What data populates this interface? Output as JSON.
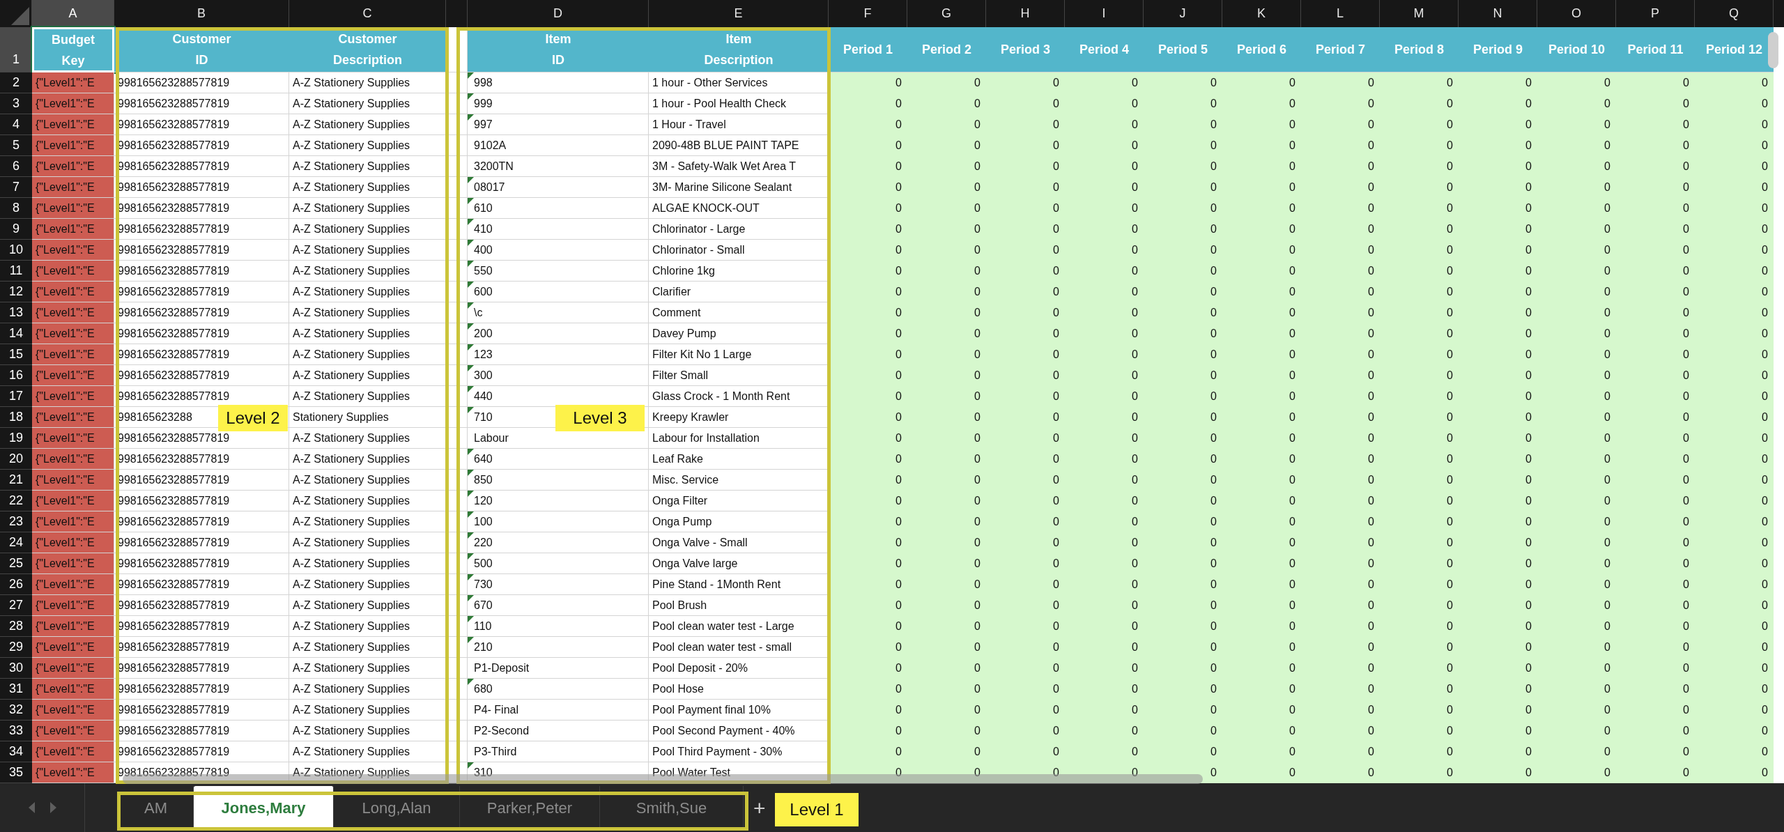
{
  "column_letters": [
    {
      "label": "A",
      "selected": true
    },
    {
      "label": "B",
      "selected": false
    },
    {
      "label": "C",
      "selected": false
    },
    {
      "label": "D",
      "selected": false
    },
    {
      "label": "E",
      "selected": false
    },
    {
      "label": "F",
      "selected": false
    },
    {
      "label": "G",
      "selected": false
    },
    {
      "label": "H",
      "selected": false
    },
    {
      "label": "I",
      "selected": false
    },
    {
      "label": "J",
      "selected": false
    },
    {
      "label": "K",
      "selected": false
    },
    {
      "label": "L",
      "selected": false
    },
    {
      "label": "M",
      "selected": false
    },
    {
      "label": "N",
      "selected": false
    },
    {
      "label": "O",
      "selected": false
    },
    {
      "label": "P",
      "selected": false
    },
    {
      "label": "Q",
      "selected": false
    }
  ],
  "header_row": {
    "number": "1",
    "selected": true,
    "cells": [
      "Budget\nKey",
      "Customer\nID",
      "Customer\nDescription",
      "Item\nID",
      "Item\nDescription",
      "Period 1",
      "Period 2",
      "Period 3",
      "Period 4",
      "Period 5",
      "Period 6",
      "Period 7",
      "Period 8",
      "Period 9",
      "Period 10",
      "Period 11",
      "Period 12"
    ]
  },
  "rows": [
    {
      "number": "2",
      "budget_key": "{\"Level1\":\"E",
      "customer_id": "998165623288577819",
      "customer_description": "A-Z Stationery Supplies",
      "item_id": "998",
      "item_flagged": true,
      "item_description": "1 hour - Other Services",
      "periods": [
        "0",
        "0",
        "0",
        "0",
        "0",
        "0",
        "0",
        "0",
        "0",
        "0",
        "0",
        "0"
      ]
    },
    {
      "number": "3",
      "budget_key": "{\"Level1\":\"E",
      "customer_id": "998165623288577819",
      "customer_description": "A-Z Stationery Supplies",
      "item_id": "999",
      "item_flagged": true,
      "item_description": "1 hour - Pool Health Check",
      "periods": [
        "0",
        "0",
        "0",
        "0",
        "0",
        "0",
        "0",
        "0",
        "0",
        "0",
        "0",
        "0"
      ]
    },
    {
      "number": "4",
      "budget_key": "{\"Level1\":\"E",
      "customer_id": "998165623288577819",
      "customer_description": "A-Z Stationery Supplies",
      "item_id": "997",
      "item_flagged": true,
      "item_description": "1 Hour - Travel",
      "periods": [
        "0",
        "0",
        "0",
        "0",
        "0",
        "0",
        "0",
        "0",
        "0",
        "0",
        "0",
        "0"
      ]
    },
    {
      "number": "5",
      "budget_key": "{\"Level1\":\"E",
      "customer_id": "998165623288577819",
      "customer_description": "A-Z Stationery Supplies",
      "item_id": "9102A",
      "item_flagged": false,
      "item_description": "2090-48B BLUE PAINT TAPE",
      "periods": [
        "0",
        "0",
        "0",
        "0",
        "0",
        "0",
        "0",
        "0",
        "0",
        "0",
        "0",
        "0"
      ]
    },
    {
      "number": "6",
      "budget_key": "{\"Level1\":\"E",
      "customer_id": "998165623288577819",
      "customer_description": "A-Z Stationery Supplies",
      "item_id": "3200TN",
      "item_flagged": false,
      "item_description": "3M - Safety-Walk Wet Area T",
      "periods": [
        "0",
        "0",
        "0",
        "0",
        "0",
        "0",
        "0",
        "0",
        "0",
        "0",
        "0",
        "0"
      ]
    },
    {
      "number": "7",
      "budget_key": "{\"Level1\":\"E",
      "customer_id": "998165623288577819",
      "customer_description": "A-Z Stationery Supplies",
      "item_id": "08017",
      "item_flagged": true,
      "item_description": "3M- Marine Silicone Sealant",
      "periods": [
        "0",
        "0",
        "0",
        "0",
        "0",
        "0",
        "0",
        "0",
        "0",
        "0",
        "0",
        "0"
      ]
    },
    {
      "number": "8",
      "budget_key": "{\"Level1\":\"E",
      "customer_id": "998165623288577819",
      "customer_description": "A-Z Stationery Supplies",
      "item_id": "610",
      "item_flagged": true,
      "item_description": "ALGAE KNOCK-OUT",
      "periods": [
        "0",
        "0",
        "0",
        "0",
        "0",
        "0",
        "0",
        "0",
        "0",
        "0",
        "0",
        "0"
      ]
    },
    {
      "number": "9",
      "budget_key": "{\"Level1\":\"E",
      "customer_id": "998165623288577819",
      "customer_description": "A-Z Stationery Supplies",
      "item_id": "410",
      "item_flagged": true,
      "item_description": "Chlorinator - Large",
      "periods": [
        "0",
        "0",
        "0",
        "0",
        "0",
        "0",
        "0",
        "0",
        "0",
        "0",
        "0",
        "0"
      ]
    },
    {
      "number": "10",
      "budget_key": "{\"Level1\":\"E",
      "customer_id": "998165623288577819",
      "customer_description": "A-Z Stationery Supplies",
      "item_id": "400",
      "item_flagged": true,
      "item_description": "Chlorinator - Small",
      "periods": [
        "0",
        "0",
        "0",
        "0",
        "0",
        "0",
        "0",
        "0",
        "0",
        "0",
        "0",
        "0"
      ]
    },
    {
      "number": "11",
      "budget_key": "{\"Level1\":\"E",
      "customer_id": "998165623288577819",
      "customer_description": "A-Z Stationery Supplies",
      "item_id": "550",
      "item_flagged": true,
      "item_description": "Chlorine 1kg",
      "periods": [
        "0",
        "0",
        "0",
        "0",
        "0",
        "0",
        "0",
        "0",
        "0",
        "0",
        "0",
        "0"
      ]
    },
    {
      "number": "12",
      "budget_key": "{\"Level1\":\"E",
      "customer_id": "998165623288577819",
      "customer_description": "A-Z Stationery Supplies",
      "item_id": "600",
      "item_flagged": true,
      "item_description": "Clarifier",
      "periods": [
        "0",
        "0",
        "0",
        "0",
        "0",
        "0",
        "0",
        "0",
        "0",
        "0",
        "0",
        "0"
      ]
    },
    {
      "number": "13",
      "budget_key": "{\"Level1\":\"E",
      "customer_id": "998165623288577819",
      "customer_description": "A-Z Stationery Supplies",
      "item_id": "\\c",
      "item_flagged": true,
      "item_description": "Comment",
      "periods": [
        "0",
        "0",
        "0",
        "0",
        "0",
        "0",
        "0",
        "0",
        "0",
        "0",
        "0",
        "0"
      ]
    },
    {
      "number": "14",
      "budget_key": "{\"Level1\":\"E",
      "customer_id": "998165623288577819",
      "customer_description": "A-Z Stationery Supplies",
      "item_id": "200",
      "item_flagged": true,
      "item_description": "Davey Pump",
      "periods": [
        "0",
        "0",
        "0",
        "0",
        "0",
        "0",
        "0",
        "0",
        "0",
        "0",
        "0",
        "0"
      ]
    },
    {
      "number": "15",
      "budget_key": "{\"Level1\":\"E",
      "customer_id": "998165623288577819",
      "customer_description": "A-Z Stationery Supplies",
      "item_id": "123",
      "item_flagged": true,
      "item_description": "Filter Kit No 1 Large",
      "periods": [
        "0",
        "0",
        "0",
        "0",
        "0",
        "0",
        "0",
        "0",
        "0",
        "0",
        "0",
        "0"
      ]
    },
    {
      "number": "16",
      "budget_key": "{\"Level1\":\"E",
      "customer_id": "998165623288577819",
      "customer_description": "A-Z Stationery Supplies",
      "item_id": "300",
      "item_flagged": true,
      "item_description": "Filter Small",
      "periods": [
        "0",
        "0",
        "0",
        "0",
        "0",
        "0",
        "0",
        "0",
        "0",
        "0",
        "0",
        "0"
      ]
    },
    {
      "number": "17",
      "budget_key": "{\"Level1\":\"E",
      "customer_id": "998165623288577819",
      "customer_description": "A-Z Stationery Supplies",
      "item_id": "440",
      "item_flagged": true,
      "item_description": "Glass Crock - 1 Month Rent",
      "periods": [
        "0",
        "0",
        "0",
        "0",
        "0",
        "0",
        "0",
        "0",
        "0",
        "0",
        "0",
        "0"
      ]
    },
    {
      "number": "18",
      "budget_key": "{\"Level1\":\"E",
      "customer_id": "998165623288",
      "customer_description": "Stationery Supplies",
      "item_id": "710",
      "item_flagged": true,
      "item_description": "Kreepy Krawler",
      "periods": [
        "0",
        "0",
        "0",
        "0",
        "0",
        "0",
        "0",
        "0",
        "0",
        "0",
        "0",
        "0"
      ]
    },
    {
      "number": "19",
      "budget_key": "{\"Level1\":\"E",
      "customer_id": "998165623288577819",
      "customer_description": "A-Z Stationery Supplies",
      "item_id": "Labour",
      "item_flagged": false,
      "item_description": "Labour for Installation",
      "periods": [
        "0",
        "0",
        "0",
        "0",
        "0",
        "0",
        "0",
        "0",
        "0",
        "0",
        "0",
        "0"
      ]
    },
    {
      "number": "20",
      "budget_key": "{\"Level1\":\"E",
      "customer_id": "998165623288577819",
      "customer_description": "A-Z Stationery Supplies",
      "item_id": "640",
      "item_flagged": true,
      "item_description": "Leaf Rake",
      "periods": [
        "0",
        "0",
        "0",
        "0",
        "0",
        "0",
        "0",
        "0",
        "0",
        "0",
        "0",
        "0"
      ]
    },
    {
      "number": "21",
      "budget_key": "{\"Level1\":\"E",
      "customer_id": "998165623288577819",
      "customer_description": "A-Z Stationery Supplies",
      "item_id": "850",
      "item_flagged": true,
      "item_description": "Misc. Service",
      "periods": [
        "0",
        "0",
        "0",
        "0",
        "0",
        "0",
        "0",
        "0",
        "0",
        "0",
        "0",
        "0"
      ]
    },
    {
      "number": "22",
      "budget_key": "{\"Level1\":\"E",
      "customer_id": "998165623288577819",
      "customer_description": "A-Z Stationery Supplies",
      "item_id": "120",
      "item_flagged": true,
      "item_description": "Onga  Filter",
      "periods": [
        "0",
        "0",
        "0",
        "0",
        "0",
        "0",
        "0",
        "0",
        "0",
        "0",
        "0",
        "0"
      ]
    },
    {
      "number": "23",
      "budget_key": "{\"Level1\":\"E",
      "customer_id": "998165623288577819",
      "customer_description": "A-Z Stationery Supplies",
      "item_id": "100",
      "item_flagged": true,
      "item_description": "Onga Pump",
      "periods": [
        "0",
        "0",
        "0",
        "0",
        "0",
        "0",
        "0",
        "0",
        "0",
        "0",
        "0",
        "0"
      ]
    },
    {
      "number": "24",
      "budget_key": "{\"Level1\":\"E",
      "customer_id": "998165623288577819",
      "customer_description": "A-Z Stationery Supplies",
      "item_id": "220",
      "item_flagged": true,
      "item_description": "Onga Valve - Small",
      "periods": [
        "0",
        "0",
        "0",
        "0",
        "0",
        "0",
        "0",
        "0",
        "0",
        "0",
        "0",
        "0"
      ]
    },
    {
      "number": "25",
      "budget_key": "{\"Level1\":\"E",
      "customer_id": "998165623288577819",
      "customer_description": "A-Z Stationery Supplies",
      "item_id": "500",
      "item_flagged": true,
      "item_description": "Onga Valve large",
      "periods": [
        "0",
        "0",
        "0",
        "0",
        "0",
        "0",
        "0",
        "0",
        "0",
        "0",
        "0",
        "0"
      ]
    },
    {
      "number": "26",
      "budget_key": "{\"Level1\":\"E",
      "customer_id": "998165623288577819",
      "customer_description": "A-Z Stationery Supplies",
      "item_id": "730",
      "item_flagged": true,
      "item_description": "Pine Stand - 1Month Rent",
      "periods": [
        "0",
        "0",
        "0",
        "0",
        "0",
        "0",
        "0",
        "0",
        "0",
        "0",
        "0",
        "0"
      ]
    },
    {
      "number": "27",
      "budget_key": "{\"Level1\":\"E",
      "customer_id": "998165623288577819",
      "customer_description": "A-Z Stationery Supplies",
      "item_id": "670",
      "item_flagged": true,
      "item_description": "Pool Brush",
      "periods": [
        "0",
        "0",
        "0",
        "0",
        "0",
        "0",
        "0",
        "0",
        "0",
        "0",
        "0",
        "0"
      ]
    },
    {
      "number": "28",
      "budget_key": "{\"Level1\":\"E",
      "customer_id": "998165623288577819",
      "customer_description": "A-Z Stationery Supplies",
      "item_id": "110",
      "item_flagged": true,
      "item_description": "Pool clean water test - Large",
      "periods": [
        "0",
        "0",
        "0",
        "0",
        "0",
        "0",
        "0",
        "0",
        "0",
        "0",
        "0",
        "0"
      ]
    },
    {
      "number": "29",
      "budget_key": "{\"Level1\":\"E",
      "customer_id": "998165623288577819",
      "customer_description": "A-Z Stationery Supplies",
      "item_id": "210",
      "item_flagged": true,
      "item_description": "Pool clean water test - small",
      "periods": [
        "0",
        "0",
        "0",
        "0",
        "0",
        "0",
        "0",
        "0",
        "0",
        "0",
        "0",
        "0"
      ]
    },
    {
      "number": "30",
      "budget_key": "{\"Level1\":\"E",
      "customer_id": "998165623288577819",
      "customer_description": "A-Z Stationery Supplies",
      "item_id": "P1-Deposit",
      "item_flagged": false,
      "item_description": "Pool Deposit - 20%",
      "periods": [
        "0",
        "0",
        "0",
        "0",
        "0",
        "0",
        "0",
        "0",
        "0",
        "0",
        "0",
        "0"
      ]
    },
    {
      "number": "31",
      "budget_key": "{\"Level1\":\"E",
      "customer_id": "998165623288577819",
      "customer_description": "A-Z Stationery Supplies",
      "item_id": "680",
      "item_flagged": true,
      "item_description": "Pool Hose",
      "periods": [
        "0",
        "0",
        "0",
        "0",
        "0",
        "0",
        "0",
        "0",
        "0",
        "0",
        "0",
        "0"
      ]
    },
    {
      "number": "32",
      "budget_key": "{\"Level1\":\"E",
      "customer_id": "998165623288577819",
      "customer_description": "A-Z Stationery Supplies",
      "item_id": "P4- Final",
      "item_flagged": false,
      "item_description": "Pool Payment final 10%",
      "periods": [
        "0",
        "0",
        "0",
        "0",
        "0",
        "0",
        "0",
        "0",
        "0",
        "0",
        "0",
        "0"
      ]
    },
    {
      "number": "33",
      "budget_key": "{\"Level1\":\"E",
      "customer_id": "998165623288577819",
      "customer_description": "A-Z Stationery Supplies",
      "item_id": "P2-Second",
      "item_flagged": false,
      "item_description": "Pool Second Payment - 40%",
      "periods": [
        "0",
        "0",
        "0",
        "0",
        "0",
        "0",
        "0",
        "0",
        "0",
        "0",
        "0",
        "0"
      ]
    },
    {
      "number": "34",
      "budget_key": "{\"Level1\":\"E",
      "customer_id": "998165623288577819",
      "customer_description": "A-Z Stationery Supplies",
      "item_id": "P3-Third",
      "item_flagged": false,
      "item_description": "Pool Third Payment - 30%",
      "periods": [
        "0",
        "0",
        "0",
        "0",
        "0",
        "0",
        "0",
        "0",
        "0",
        "0",
        "0",
        "0"
      ]
    },
    {
      "number": "35",
      "budget_key": "{\"Level1\":\"E",
      "customer_id": "998165623288577819",
      "customer_description": "A-Z Stationery Supplies",
      "item_id": "310",
      "item_flagged": true,
      "item_description": "Pool Water Test",
      "periods": [
        "0",
        "0",
        "0",
        "0",
        "0",
        "0",
        "0",
        "0",
        "0",
        "0",
        "0",
        "0"
      ]
    }
  ],
  "sheet_tabs": [
    {
      "label": "AM",
      "selected": false
    },
    {
      "label": "Jones,Mary",
      "selected": true
    },
    {
      "label": "Long,Alan",
      "selected": false
    },
    {
      "label": "Parker,Peter",
      "selected": false
    },
    {
      "label": "Smith,Sue",
      "selected": false
    }
  ],
  "add_sheet": "+",
  "annotations": [
    {
      "label": "Level 2"
    },
    {
      "label": "Level 3"
    },
    {
      "label": "Level 1"
    }
  ]
}
